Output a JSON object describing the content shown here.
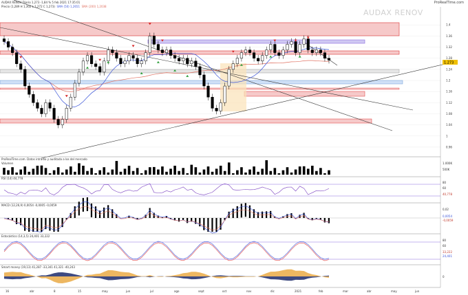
{
  "header": {
    "title": "AUDAX RENOV Diario 1,273 -1,84 % 5 feb 2021 17:35:01",
    "legend_price": "Precio (1,289 H 1,302 L 1,272 C 1,273)",
    "legend_sma50": "SMA (50) 1,2651",
    "legend_sma200": "SMA (200) 1,2038",
    "brand": "ProRealTime.com",
    "watermark": "AUDAX RENOV"
  },
  "colors": {
    "candle": "#000000",
    "sma50": "#3b55d9",
    "sma200": "#e07060",
    "resistance_zone": "#f6c9c9",
    "support_zone": "#cfe0f7",
    "purple_zone": "#cfc8f2",
    "signal_up": "#2e9e3a",
    "signal_down": "#d62020",
    "price_tag": "#f0c000"
  },
  "price_axis": {
    "ticks": [
      "1.4",
      "1.36",
      "1.32",
      "1.28",
      "1.24",
      "1.2",
      "1.16",
      "1.12",
      "1.08",
      "1.04",
      "1",
      "0.96"
    ],
    "current": "1.273",
    "current_value": 1.273
  },
  "x_axis": {
    "labels": [
      "16",
      "abr",
      "8",
      "15",
      "may",
      "jun",
      "jul",
      "ago",
      "sept",
      "oct",
      "nov",
      "dic",
      "2021",
      "feb",
      "mar",
      "abr",
      "may",
      "jun"
    ]
  },
  "panels": {
    "volume": {
      "label": "Volumen",
      "ticks": [
        "1.000K",
        "500K"
      ],
      "note": "ProRealTime.com. Datos intradía y auditada a los del mercado"
    },
    "rsi": {
      "label": "RSI (14) 44,778",
      "ticks": [
        "80",
        "60",
        "40,778"
      ]
    },
    "macd": {
      "label": "MACD (12,26,9) 0,0054 -0,0005 -0,0059",
      "ticks": [
        "0,02",
        "0,0054",
        "-0,0059"
      ]
    },
    "stochastic": {
      "label": "Estocástico (14,3,5) 24,401 33,222",
      "ticks": [
        "80",
        "60",
        "33,222",
        "24,401"
      ]
    },
    "smart_money": {
      "label": "Smart money (19,13) 41,287 -33,341 41,321 -40,243",
      "ticks": [
        "0"
      ]
    }
  },
  "chart_data": {
    "type": "candlestick",
    "title": "AUDAX RENOV Diario",
    "xlabel": "",
    "ylabel": "",
    "ylim": [
      0.94,
      1.46
    ],
    "grid": true,
    "approx_closes": [
      1.34,
      1.32,
      1.3,
      1.26,
      1.24,
      1.18,
      1.15,
      1.12,
      1.1,
      1.08,
      1.12,
      1.1,
      1.06,
      1.04,
      1.06,
      1.1,
      1.14,
      1.19,
      1.23,
      1.27,
      1.29,
      1.26,
      1.25,
      1.23,
      1.27,
      1.31,
      1.3,
      1.28,
      1.26,
      1.27,
      1.29,
      1.28,
      1.26,
      1.27,
      1.3,
      1.36,
      1.33,
      1.31,
      1.3,
      1.31,
      1.29,
      1.28,
      1.27,
      1.28,
      1.26,
      1.27,
      1.25,
      1.22,
      1.18,
      1.14,
      1.1,
      1.09,
      1.12,
      1.18,
      1.24,
      1.26,
      1.28,
      1.3,
      1.31,
      1.3,
      1.28,
      1.27,
      1.29,
      1.31,
      1.33,
      1.3,
      1.29,
      1.31,
      1.33,
      1.34,
      1.3,
      1.33,
      1.35,
      1.31,
      1.3,
      1.31,
      1.3,
      1.28,
      1.273
    ],
    "sma50_last": 1.2651,
    "sma200_last": 1.2038
  }
}
